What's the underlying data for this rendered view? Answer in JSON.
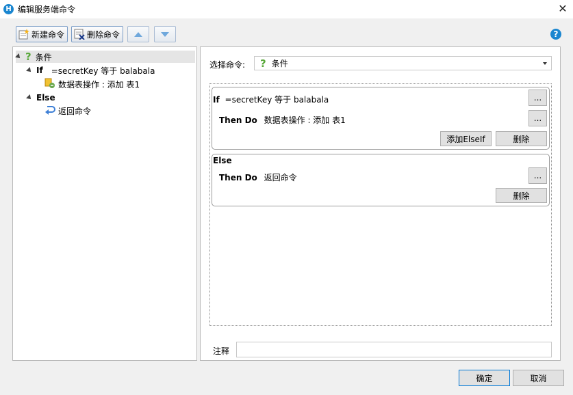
{
  "window": {
    "app_icon": "H",
    "title": "编辑服务端命令",
    "close_glyph": "✕"
  },
  "toolbar": {
    "new_label": "新建命令",
    "delete_label": "删除命令",
    "help_glyph": "?"
  },
  "tree": {
    "root_label": "条件",
    "if_keyword": "If",
    "if_condition": "=secretKey 等于 balabala",
    "if_child": "数据表操作 : 添加 表1",
    "else_keyword": "Else",
    "else_child": "返回命令"
  },
  "editor": {
    "select_label": "选择命令:",
    "select_value": "条件",
    "if_keyword": "If",
    "if_condition": "=secretKey 等于 balabala",
    "then_keyword": "Then Do",
    "if_then_value": "数据表操作 : 添加 表1",
    "ellipsis": "...",
    "add_elseif_label": "添加ElseIf",
    "delete_label": "删除",
    "else_keyword": "Else",
    "else_then_value": "返回命令",
    "note_label": "注释",
    "note_value": ""
  },
  "footer": {
    "ok_label": "确定",
    "cancel_label": "取消"
  }
}
